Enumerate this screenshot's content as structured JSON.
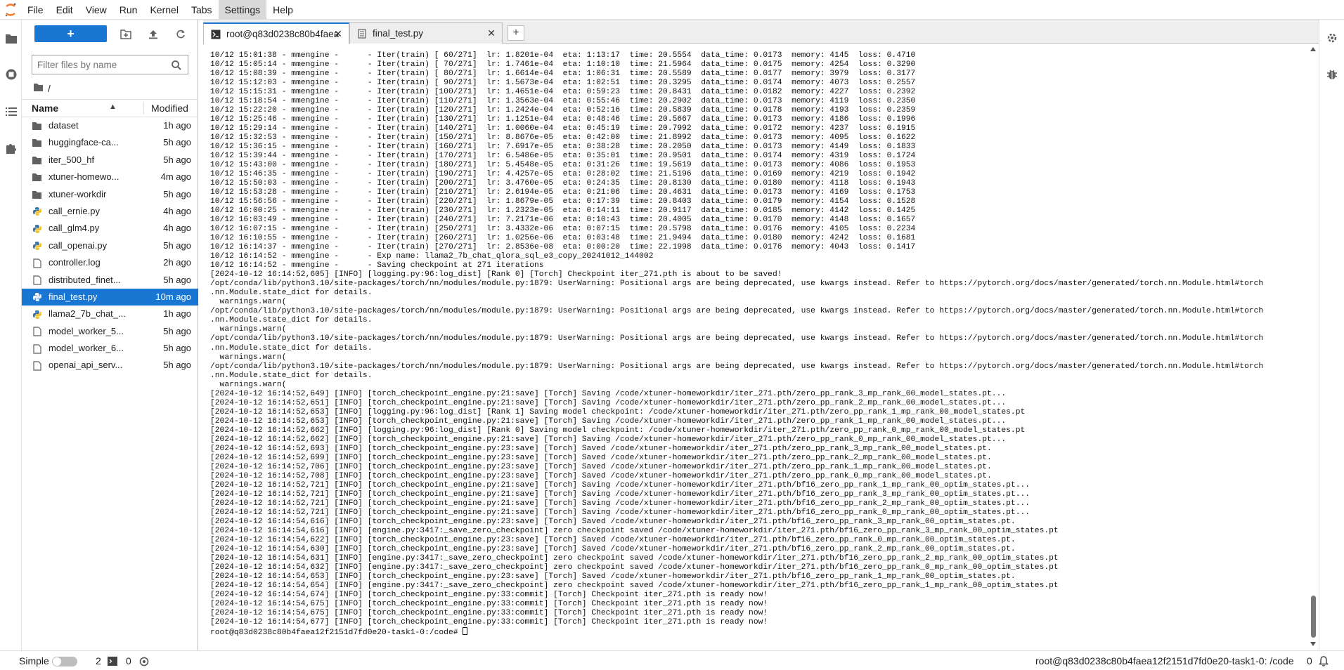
{
  "menubar": {
    "items": [
      {
        "label": "File"
      },
      {
        "label": "Edit"
      },
      {
        "label": "View"
      },
      {
        "label": "Run"
      },
      {
        "label": "Kernel"
      },
      {
        "label": "Tabs"
      },
      {
        "label": "Settings"
      },
      {
        "label": "Help"
      }
    ],
    "active": "Settings"
  },
  "filebrowser": {
    "new_label": "+",
    "filter_placeholder": "Filter files by name",
    "breadcrumb": "/",
    "header": {
      "name": "Name",
      "modified": "Modified",
      "sort_indicator": "▲"
    },
    "files": [
      {
        "name": "dataset",
        "modified": "1h ago",
        "type": "folder"
      },
      {
        "name": "huggingface-ca...",
        "modified": "5h ago",
        "type": "folder"
      },
      {
        "name": "iter_500_hf",
        "modified": "5h ago",
        "type": "folder"
      },
      {
        "name": "xtuner-homewo...",
        "modified": "4m ago",
        "type": "folder"
      },
      {
        "name": "xtuner-workdir",
        "modified": "5h ago",
        "type": "folder"
      },
      {
        "name": "call_ernie.py",
        "modified": "4h ago",
        "type": "python"
      },
      {
        "name": "call_glm4.py",
        "modified": "4h ago",
        "type": "python"
      },
      {
        "name": "call_openai.py",
        "modified": "5h ago",
        "type": "python"
      },
      {
        "name": "controller.log",
        "modified": "2h ago",
        "type": "file"
      },
      {
        "name": "distributed_finet...",
        "modified": "5h ago",
        "type": "file"
      },
      {
        "name": "final_test.py",
        "modified": "10m ago",
        "type": "python",
        "selected": true
      },
      {
        "name": "llama2_7b_chat_...",
        "modified": "1h ago",
        "type": "python"
      },
      {
        "name": "model_worker_5...",
        "modified": "5h ago",
        "type": "file"
      },
      {
        "name": "model_worker_6...",
        "modified": "5h ago",
        "type": "file"
      },
      {
        "name": "openai_api_serv...",
        "modified": "5h ago",
        "type": "file"
      }
    ]
  },
  "tabs": [
    {
      "label": "root@q83d0238c80b4faea",
      "type": "terminal",
      "active": true,
      "close": "✕"
    },
    {
      "label": "final_test.py",
      "type": "text",
      "active": false,
      "close": "✕"
    }
  ],
  "tab_add": "+",
  "terminal": {
    "lines": [
      "10/12 15:01:38 - mmengine -      - Iter(train) [ 60/271]  lr: 1.8201e-04  eta: 1:13:17  time: 20.5554  data_time: 0.0173  memory: 4145  loss: 0.4710",
      "10/12 15:05:14 - mmengine -      - Iter(train) [ 70/271]  lr: 1.7461e-04  eta: 1:10:10  time: 21.5964  data_time: 0.0175  memory: 4254  loss: 0.3290",
      "10/12 15:08:39 - mmengine -      - Iter(train) [ 80/271]  lr: 1.6614e-04  eta: 1:06:31  time: 20.5589  data_time: 0.0177  memory: 3979  loss: 0.3177",
      "10/12 15:12:03 - mmengine -      - Iter(train) [ 90/271]  lr: 1.5673e-04  eta: 1:02:51  time: 20.3295  data_time: 0.0174  memory: 4073  loss: 0.2557",
      "10/12 15:15:31 - mmengine -      - Iter(train) [100/271]  lr: 1.4651e-04  eta: 0:59:23  time: 20.8431  data_time: 0.0182  memory: 4227  loss: 0.2392",
      "10/12 15:18:54 - mmengine -      - Iter(train) [110/271]  lr: 1.3563e-04  eta: 0:55:46  time: 20.2902  data_time: 0.0173  memory: 4119  loss: 0.2350",
      "10/12 15:22:20 - mmengine -      - Iter(train) [120/271]  lr: 1.2424e-04  eta: 0:52:16  time: 20.5839  data_time: 0.0178  memory: 4193  loss: 0.2359",
      "10/12 15:25:46 - mmengine -      - Iter(train) [130/271]  lr: 1.1251e-04  eta: 0:48:46  time: 20.5667  data_time: 0.0173  memory: 4186  loss: 0.1996",
      "10/12 15:29:14 - mmengine -      - Iter(train) [140/271]  lr: 1.0060e-04  eta: 0:45:19  time: 20.7992  data_time: 0.0172  memory: 4237  loss: 0.1915",
      "10/12 15:32:53 - mmengine -      - Iter(train) [150/271]  lr: 8.8676e-05  eta: 0:42:00  time: 21.8992  data_time: 0.0173  memory: 4095  loss: 0.1622",
      "10/12 15:36:15 - mmengine -      - Iter(train) [160/271]  lr: 7.6917e-05  eta: 0:38:28  time: 20.2050  data_time: 0.0173  memory: 4149  loss: 0.1833",
      "10/12 15:39:44 - mmengine -      - Iter(train) [170/271]  lr: 6.5486e-05  eta: 0:35:01  time: 20.9501  data_time: 0.0174  memory: 4319  loss: 0.1724",
      "10/12 15:43:00 - mmengine -      - Iter(train) [180/271]  lr: 5.4548e-05  eta: 0:31:26  time: 19.5619  data_time: 0.0173  memory: 4086  loss: 0.1953",
      "10/12 15:46:35 - mmengine -      - Iter(train) [190/271]  lr: 4.4257e-05  eta: 0:28:02  time: 21.5196  data_time: 0.0169  memory: 4219  loss: 0.1942",
      "10/12 15:50:03 - mmengine -      - Iter(train) [200/271]  lr: 3.4760e-05  eta: 0:24:35  time: 20.8130  data_time: 0.0180  memory: 4118  loss: 0.1943",
      "10/12 15:53:28 - mmengine -      - Iter(train) [210/271]  lr: 2.6194e-05  eta: 0:21:06  time: 20.4631  data_time: 0.0173  memory: 4169  loss: 0.1753",
      "10/12 15:56:56 - mmengine -      - Iter(train) [220/271]  lr: 1.8679e-05  eta: 0:17:39  time: 20.8403  data_time: 0.0179  memory: 4154  loss: 0.1528",
      "10/12 16:00:25 - mmengine -      - Iter(train) [230/271]  lr: 1.2323e-05  eta: 0:14:11  time: 20.9117  data_time: 0.0185  memory: 4142  loss: 0.1425",
      "10/12 16:03:49 - mmengine -      - Iter(train) [240/271]  lr: 7.2171e-06  eta: 0:10:43  time: 20.4005  data_time: 0.0170  memory: 4148  loss: 0.1657",
      "10/12 16:07:15 - mmengine -      - Iter(train) [250/271]  lr: 3.4332e-06  eta: 0:07:15  time: 20.5798  data_time: 0.0176  memory: 4105  loss: 0.2234",
      "10/12 16:10:55 - mmengine -      - Iter(train) [260/271]  lr: 1.0256e-06  eta: 0:03:48  time: 21.9494  data_time: 0.0180  memory: 4242  loss: 0.1681",
      "10/12 16:14:37 - mmengine -      - Iter(train) [270/271]  lr: 2.8536e-08  eta: 0:00:20  time: 22.1998  data_time: 0.0176  memory: 4043  loss: 0.1417",
      "10/12 16:14:52 - mmengine -      - Exp name: llama2_7b_chat_qlora_sql_e3_copy_20241012_144002",
      "10/12 16:14:52 - mmengine -      - Saving checkpoint at 271 iterations",
      "[2024-10-12 16:14:52,605] [INFO] [logging.py:96:log_dist] [Rank 0] [Torch] Checkpoint iter_271.pth is about to be saved!",
      "/opt/conda/lib/python3.10/site-packages/torch/nn/modules/module.py:1879: UserWarning: Positional args are being deprecated, use kwargs instead. Refer to https://pytorch.org/docs/master/generated/torch.nn.Module.html#torch",
      ".nn.Module.state_dict for details.",
      "  warnings.warn(",
      "/opt/conda/lib/python3.10/site-packages/torch/nn/modules/module.py:1879: UserWarning: Positional args are being deprecated, use kwargs instead. Refer to https://pytorch.org/docs/master/generated/torch.nn.Module.html#torch",
      ".nn.Module.state_dict for details.",
      "  warnings.warn(",
      "/opt/conda/lib/python3.10/site-packages/torch/nn/modules/module.py:1879: UserWarning: Positional args are being deprecated, use kwargs instead. Refer to https://pytorch.org/docs/master/generated/torch.nn.Module.html#torch",
      ".nn.Module.state_dict for details.",
      "  warnings.warn(",
      "/opt/conda/lib/python3.10/site-packages/torch/nn/modules/module.py:1879: UserWarning: Positional args are being deprecated, use kwargs instead. Refer to https://pytorch.org/docs/master/generated/torch.nn.Module.html#torch",
      ".nn.Module.state_dict for details.",
      "  warnings.warn(",
      "[2024-10-12 16:14:52,649] [INFO] [torch_checkpoint_engine.py:21:save] [Torch] Saving /code/xtuner-homeworkdir/iter_271.pth/zero_pp_rank_3_mp_rank_00_model_states.pt...",
      "[2024-10-12 16:14:52,651] [INFO] [torch_checkpoint_engine.py:21:save] [Torch] Saving /code/xtuner-homeworkdir/iter_271.pth/zero_pp_rank_2_mp_rank_00_model_states.pt...",
      "[2024-10-12 16:14:52,653] [INFO] [logging.py:96:log_dist] [Rank 1] Saving model checkpoint: /code/xtuner-homeworkdir/iter_271.pth/zero_pp_rank_1_mp_rank_00_model_states.pt",
      "[2024-10-12 16:14:52,653] [INFO] [torch_checkpoint_engine.py:21:save] [Torch] Saving /code/xtuner-homeworkdir/iter_271.pth/zero_pp_rank_1_mp_rank_00_model_states.pt...",
      "[2024-10-12 16:14:52,662] [INFO] [logging.py:96:log_dist] [Rank 0] Saving model checkpoint: /code/xtuner-homeworkdir/iter_271.pth/zero_pp_rank_0_mp_rank_00_model_states.pt",
      "[2024-10-12 16:14:52,662] [INFO] [torch_checkpoint_engine.py:21:save] [Torch] Saving /code/xtuner-homeworkdir/iter_271.pth/zero_pp_rank_0_mp_rank_00_model_states.pt...",
      "[2024-10-12 16:14:52,693] [INFO] [torch_checkpoint_engine.py:23:save] [Torch] Saved /code/xtuner-homeworkdir/iter_271.pth/zero_pp_rank_3_mp_rank_00_model_states.pt.",
      "[2024-10-12 16:14:52,699] [INFO] [torch_checkpoint_engine.py:23:save] [Torch] Saved /code/xtuner-homeworkdir/iter_271.pth/zero_pp_rank_2_mp_rank_00_model_states.pt.",
      "[2024-10-12 16:14:52,706] [INFO] [torch_checkpoint_engine.py:23:save] [Torch] Saved /code/xtuner-homeworkdir/iter_271.pth/zero_pp_rank_1_mp_rank_00_model_states.pt.",
      "[2024-10-12 16:14:52,708] [INFO] [torch_checkpoint_engine.py:23:save] [Torch] Saved /code/xtuner-homeworkdir/iter_271.pth/zero_pp_rank_0_mp_rank_00_model_states.pt.",
      "[2024-10-12 16:14:52,721] [INFO] [torch_checkpoint_engine.py:21:save] [Torch] Saving /code/xtuner-homeworkdir/iter_271.pth/bf16_zero_pp_rank_1_mp_rank_00_optim_states.pt...",
      "[2024-10-12 16:14:52,721] [INFO] [torch_checkpoint_engine.py:21:save] [Torch] Saving /code/xtuner-homeworkdir/iter_271.pth/bf16_zero_pp_rank_3_mp_rank_00_optim_states.pt...",
      "[2024-10-12 16:14:52,721] [INFO] [torch_checkpoint_engine.py:21:save] [Torch] Saving /code/xtuner-homeworkdir/iter_271.pth/bf16_zero_pp_rank_2_mp_rank_00_optim_states.pt...",
      "[2024-10-12 16:14:52,721] [INFO] [torch_checkpoint_engine.py:21:save] [Torch] Saving /code/xtuner-homeworkdir/iter_271.pth/bf16_zero_pp_rank_0_mp_rank_00_optim_states.pt...",
      "[2024-10-12 16:14:54,616] [INFO] [torch_checkpoint_engine.py:23:save] [Torch] Saved /code/xtuner-homeworkdir/iter_271.pth/bf16_zero_pp_rank_3_mp_rank_00_optim_states.pt.",
      "[2024-10-12 16:14:54,616] [INFO] [engine.py:3417:_save_zero_checkpoint] zero checkpoint saved /code/xtuner-homeworkdir/iter_271.pth/bf16_zero_pp_rank_3_mp_rank_00_optim_states.pt",
      "[2024-10-12 16:14:54,622] [INFO] [torch_checkpoint_engine.py:23:save] [Torch] Saved /code/xtuner-homeworkdir/iter_271.pth/bf16_zero_pp_rank_0_mp_rank_00_optim_states.pt.",
      "[2024-10-12 16:14:54,630] [INFO] [torch_checkpoint_engine.py:23:save] [Torch] Saved /code/xtuner-homeworkdir/iter_271.pth/bf16_zero_pp_rank_2_mp_rank_00_optim_states.pt.",
      "[2024-10-12 16:14:54,631] [INFO] [engine.py:3417:_save_zero_checkpoint] zero checkpoint saved /code/xtuner-homeworkdir/iter_271.pth/bf16_zero_pp_rank_2_mp_rank_00_optim_states.pt",
      "[2024-10-12 16:14:54,632] [INFO] [engine.py:3417:_save_zero_checkpoint] zero checkpoint saved /code/xtuner-homeworkdir/iter_271.pth/bf16_zero_pp_rank_0_mp_rank_00_optim_states.pt",
      "[2024-10-12 16:14:54,653] [INFO] [torch_checkpoint_engine.py:23:save] [Torch] Saved /code/xtuner-homeworkdir/iter_271.pth/bf16_zero_pp_rank_1_mp_rank_00_optim_states.pt.",
      "[2024-10-12 16:14:54,654] [INFO] [engine.py:3417:_save_zero_checkpoint] zero checkpoint saved /code/xtuner-homeworkdir/iter_271.pth/bf16_zero_pp_rank_1_mp_rank_00_optim_states.pt",
      "[2024-10-12 16:14:54,674] [INFO] [torch_checkpoint_engine.py:33:commit] [Torch] Checkpoint iter_271.pth is ready now!",
      "[2024-10-12 16:14:54,675] [INFO] [torch_checkpoint_engine.py:33:commit] [Torch] Checkpoint iter_271.pth is ready now!",
      "[2024-10-12 16:14:54,675] [INFO] [torch_checkpoint_engine.py:33:commit] [Torch] Checkpoint iter_271.pth is ready now!",
      "[2024-10-12 16:14:54,677] [INFO] [torch_checkpoint_engine.py:33:commit] [Torch] Checkpoint iter_271.pth is ready now!"
    ],
    "prompt": "root@q83d0238c80b4faea12f2151d7fd0e20-task1-0:/code# "
  },
  "statusbar": {
    "mode_label": "Simple",
    "terminals_count": "2",
    "kernels_count": "0",
    "terminal_name": "root@q83d0238c80b4faea12f2151d7fd0e20-task1-0: /code",
    "notifications_count": "0"
  },
  "colors": {
    "accent": "#1976d2",
    "logo": "#f37726"
  }
}
